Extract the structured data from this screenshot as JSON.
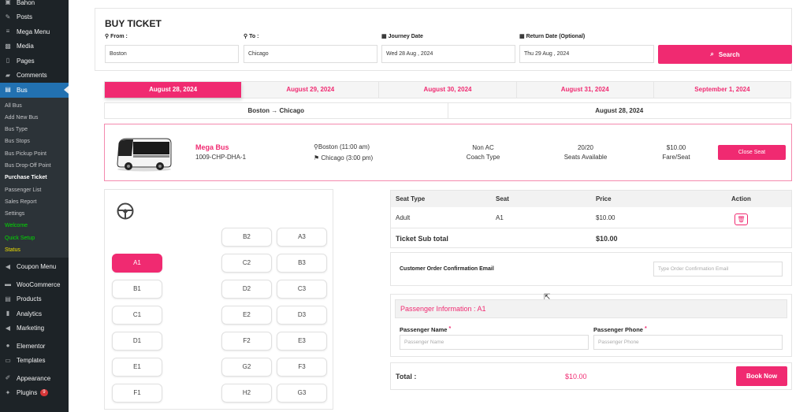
{
  "sidebar": {
    "top_items": [
      {
        "label": "Bahon",
        "icon": "bus-icon"
      },
      {
        "label": "Posts",
        "icon": "pin-icon"
      },
      {
        "label": "Mega Menu",
        "icon": "menu-icon"
      },
      {
        "label": "Media",
        "icon": "media-icon"
      },
      {
        "label": "Pages",
        "icon": "page-icon"
      },
      {
        "label": "Comments",
        "icon": "comment-icon"
      }
    ],
    "active_item": {
      "label": "Bus",
      "icon": "list-icon"
    },
    "submenu": [
      {
        "label": "All Bus",
        "style": "normal"
      },
      {
        "label": "Add New Bus",
        "style": "normal"
      },
      {
        "label": "Bus Type",
        "style": "normal"
      },
      {
        "label": "Bus Stops",
        "style": "normal"
      },
      {
        "label": "Bus Pickup Point",
        "style": "normal"
      },
      {
        "label": "Bus Drop-Off Point",
        "style": "normal"
      },
      {
        "label": "Purchase Ticket",
        "style": "current"
      },
      {
        "label": "Passenger List",
        "style": "normal"
      },
      {
        "label": "Sales Report",
        "style": "normal"
      },
      {
        "label": "Settings",
        "style": "normal"
      },
      {
        "label": "Welcome",
        "style": "green"
      },
      {
        "label": "Quick Setup",
        "style": "green"
      },
      {
        "label": "Status",
        "style": "yellow"
      }
    ],
    "bottom_items": [
      {
        "label": "Coupon Menu",
        "icon": "megaphone-icon"
      },
      {
        "label": "WooCommerce",
        "icon": "woo-icon"
      },
      {
        "label": "Products",
        "icon": "archive-icon"
      },
      {
        "label": "Analytics",
        "icon": "chart-icon"
      },
      {
        "label": "Marketing",
        "icon": "megaphone-icon"
      },
      {
        "label": "Elementor",
        "icon": "elementor-icon"
      },
      {
        "label": "Templates",
        "icon": "folder-icon"
      },
      {
        "label": "Appearance",
        "icon": "brush-icon"
      },
      {
        "label": "Plugins",
        "icon": "plugin-icon",
        "badge": "9"
      }
    ]
  },
  "search": {
    "title": "BUY TICKET",
    "from_label": "From :",
    "from_value": "Boston",
    "to_label": "To :",
    "to_value": "Chicago",
    "journey_label": "Journey Date",
    "journey_value": "Wed 28 Aug , 2024",
    "return_label": "Return Date (Optional)",
    "return_value": "Thu 29 Aug , 2024",
    "search_label": "Search"
  },
  "date_tabs": [
    {
      "label": "August 28, 2024",
      "active": true
    },
    {
      "label": "August 29, 2024",
      "active": false
    },
    {
      "label": "August 30, 2024",
      "active": false
    },
    {
      "label": "August 31, 2024",
      "active": false
    },
    {
      "label": "September 1, 2024",
      "active": false
    }
  ],
  "route": {
    "from": "Boston",
    "arrow": "→",
    "to": "Chicago",
    "date": "August 28, 2024"
  },
  "bus": {
    "name": "Mega Bus",
    "code": "1009-CHP-DHA-1",
    "boarding": "Boston (11:00 am)",
    "dropping": "Chicago (3:00 pm)",
    "ac_type": "Non AC",
    "coach_type": "Coach Type",
    "seats_count": "20/20",
    "seats_label": "Seats Available",
    "fare": "$10.00",
    "fare_label": "Fare/Seat",
    "close_label": "Close Seat"
  },
  "seats": {
    "right_top": [
      "B2",
      "A3"
    ],
    "rows": [
      {
        "left": "A1",
        "mid": "C2",
        "right": "B3"
      },
      {
        "left": "B1",
        "mid": "D2",
        "right": "C3"
      },
      {
        "left": "C1",
        "mid": "E2",
        "right": "D3"
      },
      {
        "left": "D1",
        "mid": "F2",
        "right": "E3"
      },
      {
        "left": "E1",
        "mid": "G2",
        "right": "F3"
      },
      {
        "left": "F1",
        "mid": "H2",
        "right": "G3"
      }
    ],
    "selected": "A1"
  },
  "ticket": {
    "headers": [
      "Seat Type",
      "Seat",
      "Price",
      "Action"
    ],
    "row": {
      "type": "Adult",
      "seat": "A1",
      "price": "$10.00"
    },
    "subtotal_label": "Ticket Sub total",
    "subtotal_value": "$10.00"
  },
  "email": {
    "label": "Customer Order Confirmation Email",
    "placeholder": "Type Order Confirmation Email"
  },
  "passenger": {
    "title": "Passenger Information : A1",
    "name_label": "Passenger Name",
    "name_placeholder": "Passenger Name",
    "phone_label": "Passenger Phone",
    "phone_placeholder": "Passenger Phone",
    "required_mark": "*"
  },
  "total": {
    "label": "Total :",
    "value": "$10.00",
    "book_label": "Book Now"
  },
  "colors": {
    "accent": "#f02a71",
    "sidebar_bg": "#1d2327",
    "sidebar_active": "#2271b1"
  }
}
